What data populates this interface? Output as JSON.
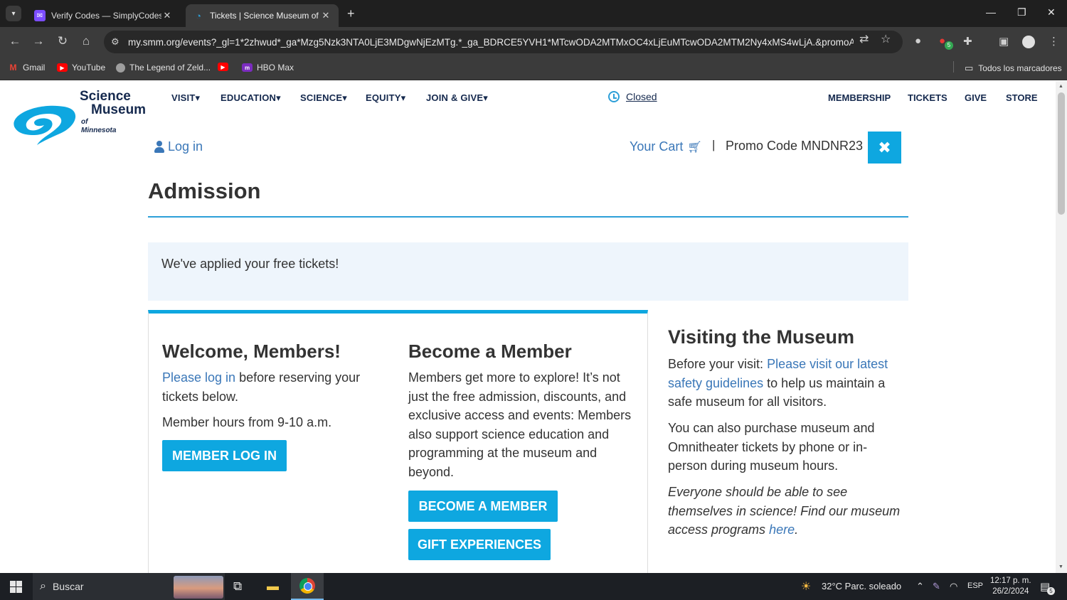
{
  "browser": {
    "tabs": [
      {
        "title": "Verify Codes — SimplyCodes",
        "active": false,
        "favicon": "simplycodes-icon"
      },
      {
        "title": "Tickets | Science Museum of Mi",
        "active": true,
        "favicon": "smm-icon"
      }
    ],
    "url": "my.smm.org/events?_gl=1*2zhwud*_ga*Mzg5Nzk3NTA0LjE3MDgwNjEzMTg.*_ga_BDRCE5YVH1*MTcwODA2MTMxOC4xLjEuMTcwODA2MTM2Ny4xMS4wLjA.&promoApplied=t...",
    "extension_badge": "5",
    "bookmarks": [
      {
        "label": "Gmail",
        "color": "#ea4335"
      },
      {
        "label": "YouTube",
        "color": "#ff0000"
      },
      {
        "label": "The Legend of Zeld...",
        "color": "#888888"
      },
      {
        "label": "",
        "color": "#ff0000"
      },
      {
        "label": "HBO Max",
        "color": "#7b2cbf"
      }
    ],
    "all_bookmarks": "Todos los marcadores"
  },
  "site": {
    "logo": {
      "line1": "Science",
      "line2": "Museum",
      "line3": "of Minnesota"
    },
    "nav": [
      "VISIT",
      "EDUCATION",
      "SCIENCE",
      "EQUITY",
      "JOIN & GIVE"
    ],
    "status": "Closed",
    "right_nav": [
      "MEMBERSHIP",
      "TICKETS",
      "GIVE",
      "STORE"
    ],
    "login": "Log in",
    "cart": "Your Cart",
    "pipe": "|",
    "promo": "Promo Code MNDNR23",
    "promo_remove": "✖"
  },
  "page": {
    "title": "Admission",
    "alert": "We've applied your free tickets!",
    "welcome": {
      "heading": "Welcome, Members!",
      "link": "Please log in",
      "text": " before reserving your tickets below.",
      "hours": "Member hours from 9-10 a.m.",
      "button": "MEMBER LOG IN"
    },
    "become": {
      "heading": "Become a Member",
      "text": "Members get more to explore! It’s not just the free admission, discounts, and exclusive access and events: Members also support science education and programming at the museum and beyond.",
      "button1": "BECOME A MEMBER",
      "button2": "GIFT EXPERIENCES"
    },
    "visiting": {
      "heading": "Visiting the Museum",
      "p1_pre": "Before your visit: ",
      "p1_link": "Please visit our latest safety guidelines",
      "p1_post": " to help us maintain a safe museum for all visitors.",
      "p2": "You can also purchase museum and Omnitheater tickets by phone or in-person during museum hours.",
      "p3_pre": "Everyone should be able to see themselves in science! Find our museum access programs ",
      "p3_link": "here",
      "p3_post": "."
    }
  },
  "taskbar": {
    "search": "Buscar",
    "weather": "32°C  Parc. soleado",
    "lang": "ESP",
    "time": "12:17 p. m.",
    "date": "26/2/2024",
    "notifications": "5"
  },
  "colors": {
    "accent": "#0ea7e0",
    "link": "#3a77b8",
    "navy": "#15294e"
  }
}
